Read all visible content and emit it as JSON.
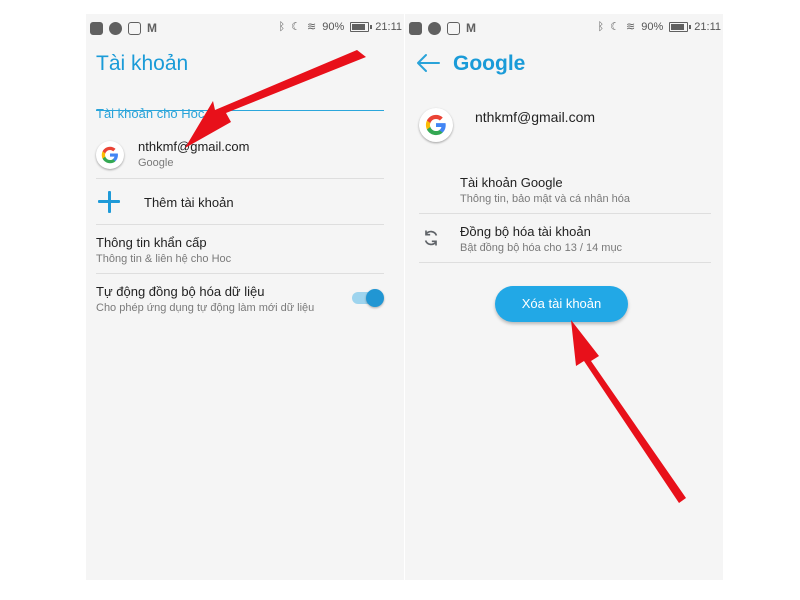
{
  "status_bar": {
    "battery": "90%",
    "time": "21:11"
  },
  "left_screen": {
    "title": "Tài khoản",
    "section_header": "Tài khoản cho Hoc",
    "account": {
      "email": "nthkmf@gmail.com",
      "type": "Google"
    },
    "add_account_label": "Thêm tài khoản",
    "emergency": {
      "title": "Thông tin khẩn cấp",
      "subtitle": "Thông tin & liên hệ cho Hoc"
    },
    "auto_sync": {
      "title": "Tự động đồng bộ hóa dữ liệu",
      "subtitle": "Cho phép ứng dụng tự động làm mới dữ liệu",
      "enabled": true
    }
  },
  "right_screen": {
    "title": "Google",
    "account_email": "nthkmf@gmail.com",
    "google_account": {
      "title": "Tài khoản Google",
      "subtitle": "Thông tin, bảo mật và cá nhân hóa"
    },
    "sync": {
      "title": "Đồng bộ hóa tài khoản",
      "subtitle": "Bật đồng bộ hóa cho 13 / 14 mục"
    },
    "remove_button": "Xóa tài khoản"
  },
  "colors": {
    "accent": "#1a9bd8",
    "button": "#22a8e6",
    "arrow": "#e8101a"
  },
  "icons": [
    "back-arrow-icon",
    "google-logo-icon",
    "plus-icon",
    "sync-icon",
    "toggle-switch"
  ]
}
